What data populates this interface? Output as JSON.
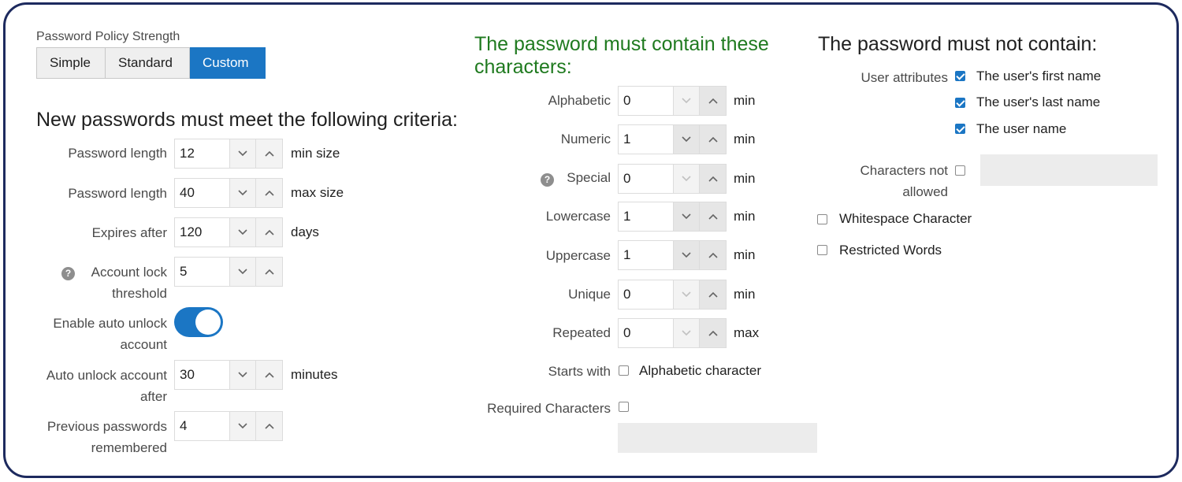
{
  "left": {
    "policy_strength_label": "Password Policy Strength",
    "segments": [
      "Simple",
      "Standard",
      "Custom"
    ],
    "selected_segment": "Custom",
    "criteria_heading": "New passwords must meet the following criteria:",
    "rows": [
      {
        "label": "Password length",
        "value": "12",
        "unit": "min size"
      },
      {
        "label": "Password length",
        "value": "40",
        "unit": "max size"
      },
      {
        "label": "Expires after",
        "value": "120",
        "unit": "days"
      },
      {
        "label": "Account lock threshold",
        "value": "5",
        "unit": ""
      },
      {
        "label": "Auto unlock account after",
        "value": "30",
        "unit": "minutes"
      },
      {
        "label": "Previous passwords remembered",
        "value": "4",
        "unit": ""
      }
    ],
    "auto_unlock_label": "Enable auto unlock account",
    "auto_unlock_on": true
  },
  "middle": {
    "heading": "The password must contain these characters:",
    "heading_color": "#1f7a1f",
    "rows": [
      {
        "label": "Alphabetic",
        "value": "0",
        "unit": "min"
      },
      {
        "label": "Numeric",
        "value": "1",
        "unit": "min"
      },
      {
        "label": "Special",
        "value": "0",
        "unit": "min"
      },
      {
        "label": "Lowercase",
        "value": "1",
        "unit": "min"
      },
      {
        "label": "Uppercase",
        "value": "1",
        "unit": "min"
      },
      {
        "label": "Unique",
        "value": "0",
        "unit": "min"
      },
      {
        "label": "Repeated",
        "value": "0",
        "unit": "max"
      }
    ],
    "starts_with_label": "Starts with",
    "starts_with_option": "Alphabetic character",
    "starts_with_checked": false,
    "required_chars_label": "Required Characters",
    "required_chars_checked": false
  },
  "right": {
    "heading": "The password must not contain:",
    "user_attributes_label": "User attributes",
    "attributes": [
      {
        "label": "The user's first name",
        "checked": true
      },
      {
        "label": "The user's last name",
        "checked": true
      },
      {
        "label": "The user name",
        "checked": true
      }
    ],
    "chars_not_allowed_label": "Characters not allowed",
    "chars_not_allowed_checked": false,
    "whitespace_label": "Whitespace Character",
    "whitespace_checked": false,
    "restricted_words_label": "Restricted Words",
    "restricted_words_checked": false
  },
  "colors": {
    "accent": "#1b76c4",
    "border": "#1d2a5e"
  },
  "icons": {
    "down": "chevron-down-icon",
    "up": "chevron-up-icon",
    "help": "help-circle-icon"
  }
}
